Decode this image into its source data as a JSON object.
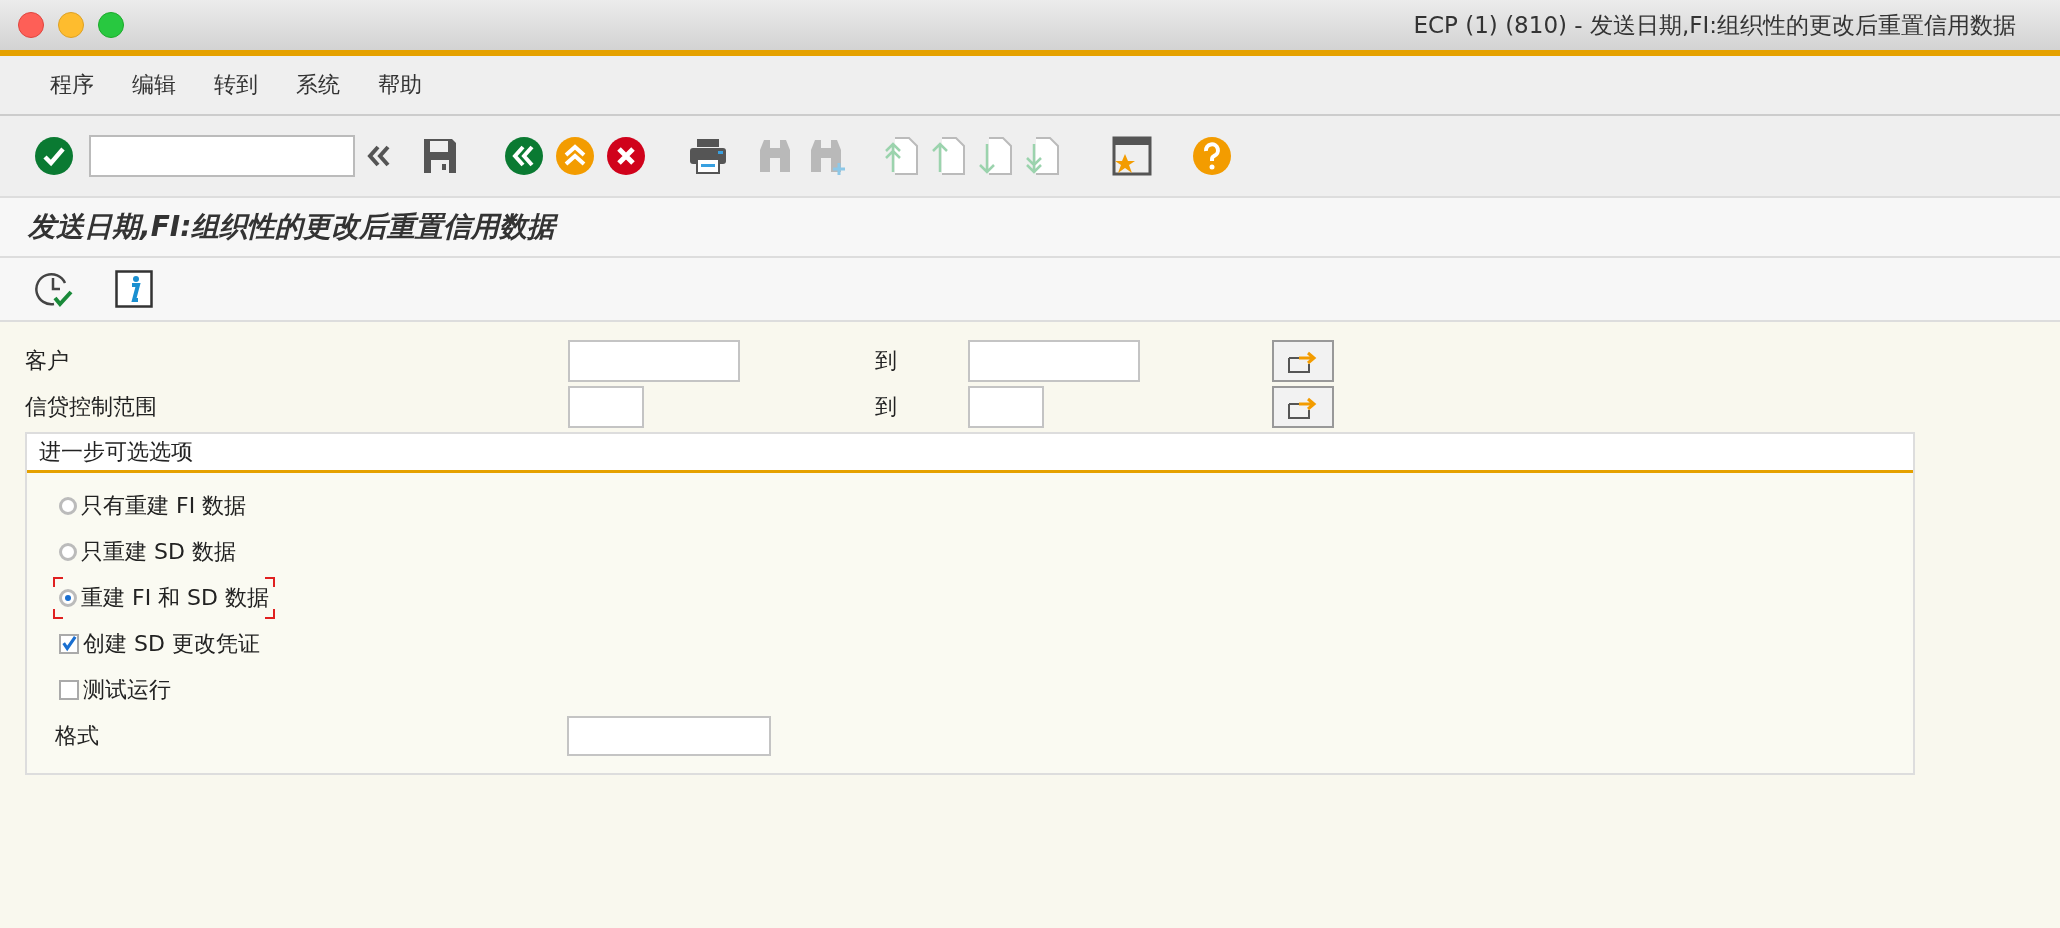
{
  "window": {
    "title": "ECP (1) (810) - 发送日期,FI:组织性的更改后重置信用数据"
  },
  "menu": [
    {
      "label": "程序"
    },
    {
      "label": "编辑"
    },
    {
      "label": "转到"
    },
    {
      "label": "系统"
    },
    {
      "label": "帮助"
    }
  ],
  "toolbar": [
    {
      "kind": "ok",
      "disabled": false
    },
    {
      "kind": "command"
    },
    {
      "kind": "save",
      "disabled": false
    },
    {
      "kind": "back",
      "disabled": false
    },
    {
      "kind": "exit",
      "disabled": false
    },
    {
      "kind": "cancel",
      "disabled": false
    },
    {
      "kind": "print",
      "disabled": false
    },
    {
      "kind": "find",
      "disabled": true
    },
    {
      "kind": "find_next",
      "disabled": true
    },
    {
      "kind": "first_page",
      "disabled": true
    },
    {
      "kind": "previous_page",
      "disabled": true
    },
    {
      "kind": "next_page",
      "disabled": true
    },
    {
      "kind": "last_page",
      "disabled": true
    },
    {
      "kind": "layout",
      "disabled": false
    },
    {
      "kind": "help",
      "disabled": false
    }
  ],
  "screen_title": "发送日期,FI:组织性的更改后重置信用数据",
  "app_toolbar": [
    {
      "kind": "execute"
    },
    {
      "kind": "info"
    }
  ],
  "selection": [
    {
      "label": "客户",
      "to_label": "到",
      "kind": "wide"
    },
    {
      "label": "信贷控制范围",
      "to_label": "到",
      "kind": "narrow"
    }
  ],
  "options": {
    "title": "进一步可选选项",
    "items": [
      {
        "kind": "radio",
        "label": "只有重建 FI 数据",
        "selected": false,
        "focused": false
      },
      {
        "kind": "radio",
        "label": "只重建 SD 数据",
        "selected": false,
        "focused": false
      },
      {
        "kind": "radio",
        "label": "重建 FI 和 SD 数据",
        "selected": true,
        "focused": true
      },
      {
        "kind": "checkbox",
        "label": "创建 SD 更改凭证",
        "checked": true,
        "focused": false
      },
      {
        "kind": "checkbox",
        "label": "测试运行",
        "checked": false,
        "focused": false
      },
      {
        "kind": "field",
        "label": "格式"
      }
    ]
  }
}
